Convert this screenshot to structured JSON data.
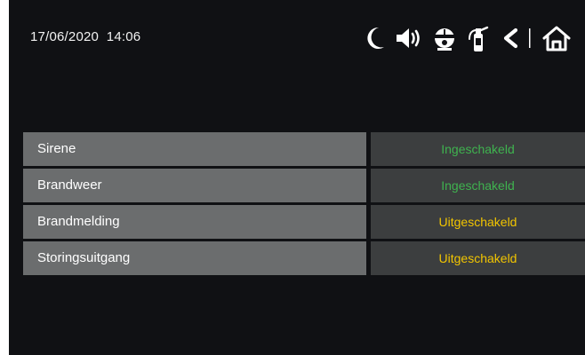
{
  "status_bar": {
    "datetime": "17/06/2020  14:06"
  },
  "icons": [
    "moon-icon",
    "speaker-icon",
    "firefighter-helmet-icon",
    "fire-extinguisher-icon",
    "back-chevron-icon",
    "home-icon"
  ],
  "colors": {
    "background": "#101114",
    "label_bg": "#6b6d6e",
    "value_bg": "#3c3e3f",
    "status_on": "#3fb34f",
    "status_off": "#f2c500"
  },
  "settings": [
    {
      "label": "Sirene",
      "value": "Ingeschakeld",
      "state": "on"
    },
    {
      "label": "Brandweer",
      "value": "Ingeschakeld",
      "state": "on"
    },
    {
      "label": "Brandmelding",
      "value": "Uitgeschakeld",
      "state": "off"
    },
    {
      "label": "Storingsuitgang",
      "value": "Uitgeschakeld",
      "state": "off"
    }
  ]
}
